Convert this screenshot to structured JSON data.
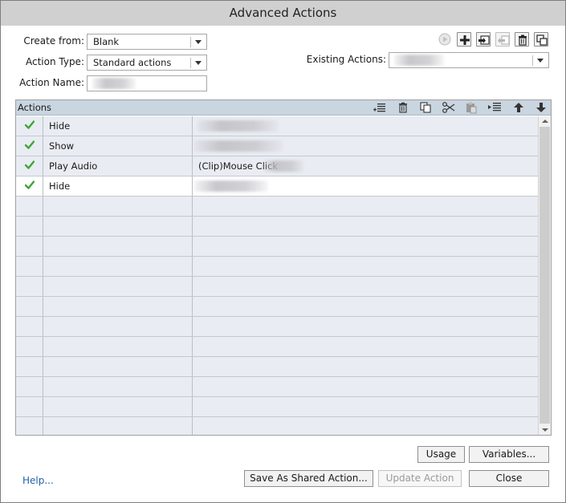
{
  "window": {
    "title": "Advanced Actions"
  },
  "form": {
    "create_from_label": "Create from:",
    "create_from_value": "Blank",
    "action_type_label": "Action Type:",
    "action_type_value": "Standard actions",
    "action_name_label": "Action Name:",
    "action_name_value": "",
    "existing_actions_label": "Existing Actions:",
    "existing_actions_value": ""
  },
  "toolbar_icons": [
    "preview-icon",
    "add-icon",
    "import-icon",
    "export-icon",
    "delete-icon",
    "duplicate-icon"
  ],
  "grid": {
    "header_label": "Actions",
    "header_icons": [
      "insert-row-icon",
      "delete-row-icon",
      "copy-icon",
      "cut-icon",
      "paste-icon",
      "indent-icon",
      "move-up-icon",
      "move-down-icon"
    ],
    "rows": [
      {
        "status": "check",
        "action": "Hide",
        "target": ""
      },
      {
        "status": "check",
        "action": "Show",
        "target": ""
      },
      {
        "status": "check",
        "action": "Play Audio",
        "target": "(Clip)Mouse Click"
      },
      {
        "status": "check",
        "action": "Hide",
        "target": "",
        "selected": true
      }
    ],
    "empty_rows": 12
  },
  "buttons": {
    "usage": "Usage",
    "variables": "Variables...",
    "save_shared": "Save As Shared Action...",
    "update": "Update Action",
    "close": "Close",
    "help": "Help..."
  },
  "colors": {
    "accent_link": "#2363a7",
    "check_green": "#3fa535",
    "grid_header": "#c9d5df",
    "row_bg": "#e9ecf2"
  }
}
